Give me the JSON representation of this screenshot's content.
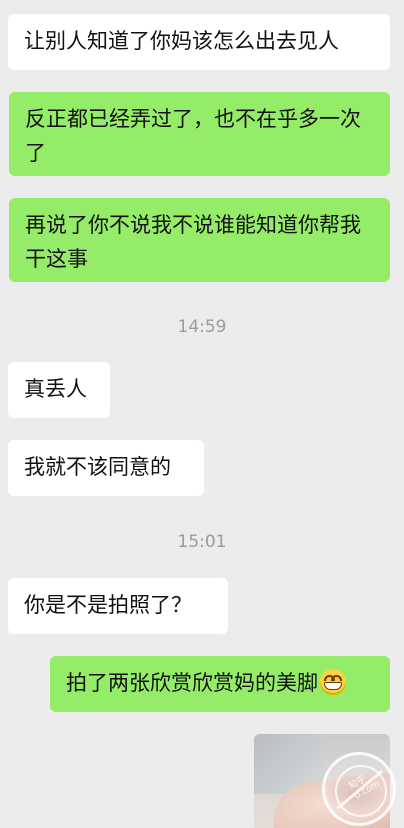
{
  "messages": [
    {
      "side": "left",
      "color": "white",
      "text": "让别人知道了你妈该怎么出去见人"
    },
    {
      "side": "right",
      "color": "green",
      "text": "反正都已经弄过了，也不在乎多一次了"
    },
    {
      "side": "right",
      "color": "green",
      "text": "再说了你不说我不说谁能知道你帮我干这事"
    },
    {
      "timestamp": "14:59"
    },
    {
      "side": "left",
      "color": "white",
      "text": "真丢人"
    },
    {
      "side": "left",
      "color": "white",
      "text": "我就不该同意的"
    },
    {
      "timestamp": "15:01"
    },
    {
      "side": "left",
      "color": "white",
      "text": "你是不是拍照了？"
    },
    {
      "side": "right",
      "color": "green",
      "text": "拍了两张欣赏欣赏妈的美脚",
      "emoji": "grinning-face-emoji"
    },
    {
      "side": "right",
      "type": "image",
      "image": "photo-thumbnail"
    }
  ],
  "watermark": {
    "text_line1": "知乎",
    "text_line2": "o.com",
    "icon": "watermark-logo-icon"
  },
  "colors": {
    "background": "#ececec",
    "incoming_bubble": "#ffffff",
    "outgoing_bubble": "#95ec69",
    "timestamp_text": "#9b9b9b"
  }
}
